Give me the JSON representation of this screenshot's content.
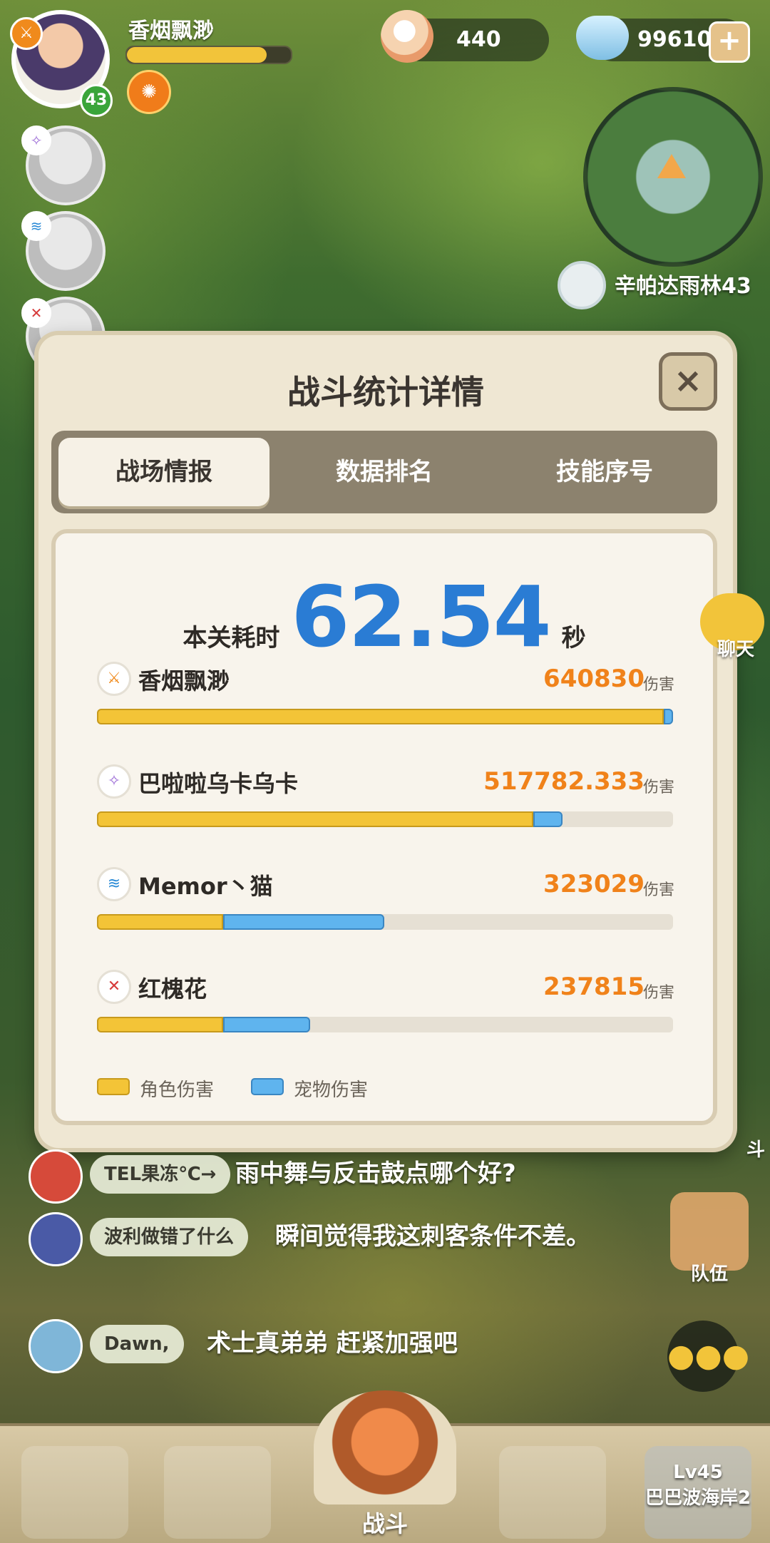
{
  "player": {
    "name": "香烟飘渺",
    "level": "43",
    "hp_fraction": 0.85
  },
  "currency": {
    "pearls": "440",
    "gems": "99610",
    "plus": "+"
  },
  "map": {
    "location": "辛帕达雨林43"
  },
  "panel": {
    "title": "战斗统计详情",
    "close": "×",
    "tabs": [
      "战场情报",
      "数据排名",
      "技能序号"
    ],
    "active_tab": 0,
    "time_label": "本关耗时",
    "time_value": "62.54",
    "time_unit": "秒",
    "damage_unit": "伤害",
    "rows": [
      {
        "name": "香烟飘渺",
        "value": "640830",
        "role_fraction": 0.984,
        "pet_fraction": 0.016,
        "icon": "axe-class-icon",
        "color": "#f08a1c"
      },
      {
        "name": "巴啦啦乌卡乌卡",
        "value": "517782.333",
        "role_fraction": 0.757,
        "pet_fraction": 0.051,
        "icon": "swirl-class-icon",
        "color": "#9b6ad6"
      },
      {
        "name": "Memor丶猫",
        "value": "323029",
        "role_fraction": 0.219,
        "pet_fraction": 0.28,
        "icon": "wave-class-icon",
        "color": "#2a8ad6"
      },
      {
        "name": "红槐花",
        "value": "237815",
        "role_fraction": 0.219,
        "pet_fraction": 0.151,
        "icon": "shield-class-icon",
        "color": "#d63a3a"
      }
    ],
    "legend": {
      "role": "角色伤害",
      "pet": "宠物伤害"
    }
  },
  "colors": {
    "role": "#f3c437",
    "pet": "#5fb4ee",
    "time": "#2a7cd4",
    "damage": "#f0821a"
  },
  "side": {
    "chat": "聊天",
    "team": "队伍",
    "fight": "斗"
  },
  "chat": [
    {
      "name": "TEL果冻℃→",
      "text": "雨中舞与反击鼓点哪个好?"
    },
    {
      "name": "波利做错了什么",
      "text": "瞬间觉得我这刺客条件不差。"
    },
    {
      "name": "Dawn,",
      "text": "术士真弟弟 赶紧加强吧"
    }
  ],
  "bottom_nav": {
    "center_label": "战斗",
    "lock_level": "Lv45",
    "lock_place": "巴巴波海岸2"
  }
}
